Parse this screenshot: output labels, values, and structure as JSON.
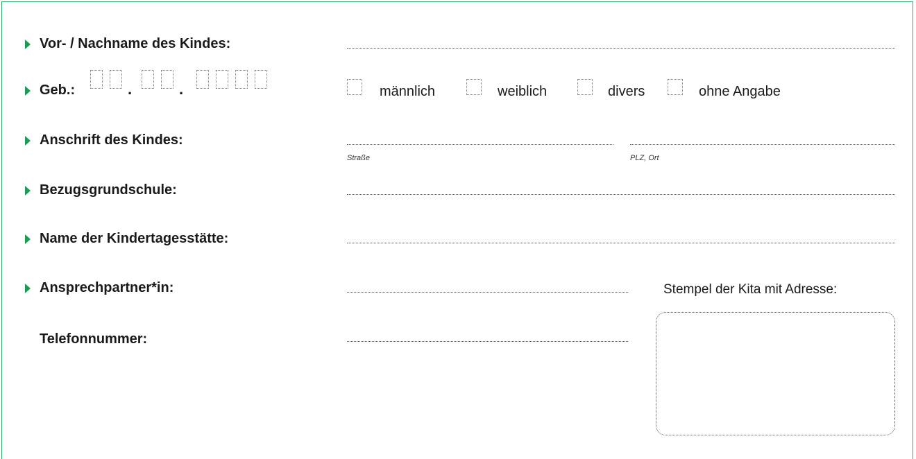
{
  "form": {
    "child_name_label": "Vor- / Nachname des Kindes:",
    "birth_label": "Geb.:",
    "date_separator": ".",
    "gender_options": [
      "männlich",
      "weiblich",
      "divers",
      "ohne Angabe"
    ],
    "address_label": "Anschrift des Kindes:",
    "street_caption": "Straße",
    "city_caption": "PLZ, Ort",
    "school_label": "Bezugsgrundschule:",
    "daycare_label": "Name der Kindertagesstätte:",
    "contact_label": "Ansprechpartner*in:",
    "phone_label": "Telefonnummer:",
    "stamp_label": "Stempel der Kita mit Adresse:"
  },
  "colors": {
    "accent": "#1f9a55",
    "frame": "#2aa86a"
  },
  "icons": {
    "bullet": "triangle-right-icon"
  }
}
